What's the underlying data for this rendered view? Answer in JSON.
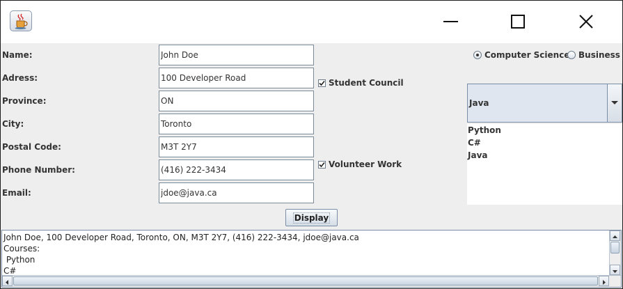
{
  "window": {
    "app_icon": "java-cup-icon",
    "controls": [
      "minimize-icon",
      "maximize-icon",
      "close-icon"
    ]
  },
  "form": {
    "fields": [
      {
        "key": "name",
        "label": "Name:",
        "value": "John Doe"
      },
      {
        "key": "address",
        "label": "Adress:",
        "value": "100 Developer Road"
      },
      {
        "key": "province",
        "label": "Province:",
        "value": "ON"
      },
      {
        "key": "city",
        "label": "City:",
        "value": "Toronto"
      },
      {
        "key": "postal",
        "label": "Postal Code:",
        "value": "M3T 2Y7"
      },
      {
        "key": "phone",
        "label": "Phone Number:",
        "value": "(416) 222-3434"
      },
      {
        "key": "email",
        "label": "Email:",
        "value": "jdoe@java.ca"
      }
    ]
  },
  "checkboxes": {
    "student_council": {
      "label": "Student Council",
      "checked": true
    },
    "volunteer_work": {
      "label": "Volunteer Work",
      "checked": true
    }
  },
  "program": {
    "options": [
      {
        "label": "Computer Science",
        "selected": true
      },
      {
        "label": "Business",
        "selected": false
      }
    ]
  },
  "courses": {
    "combo_value": "Java",
    "list": [
      "Python",
      "C#",
      "Java"
    ]
  },
  "display_button": {
    "label": "Display"
  },
  "output": {
    "text": "John Doe, 100 Developer Road, Toronto, ON, M3T 2Y7, (416) 222-3434, jdoe@java.ca\nCourses:\n Python\nC#"
  },
  "colors": {
    "panel": "#eeeeee",
    "field_border": "#7a8a99",
    "text": "#333333"
  }
}
